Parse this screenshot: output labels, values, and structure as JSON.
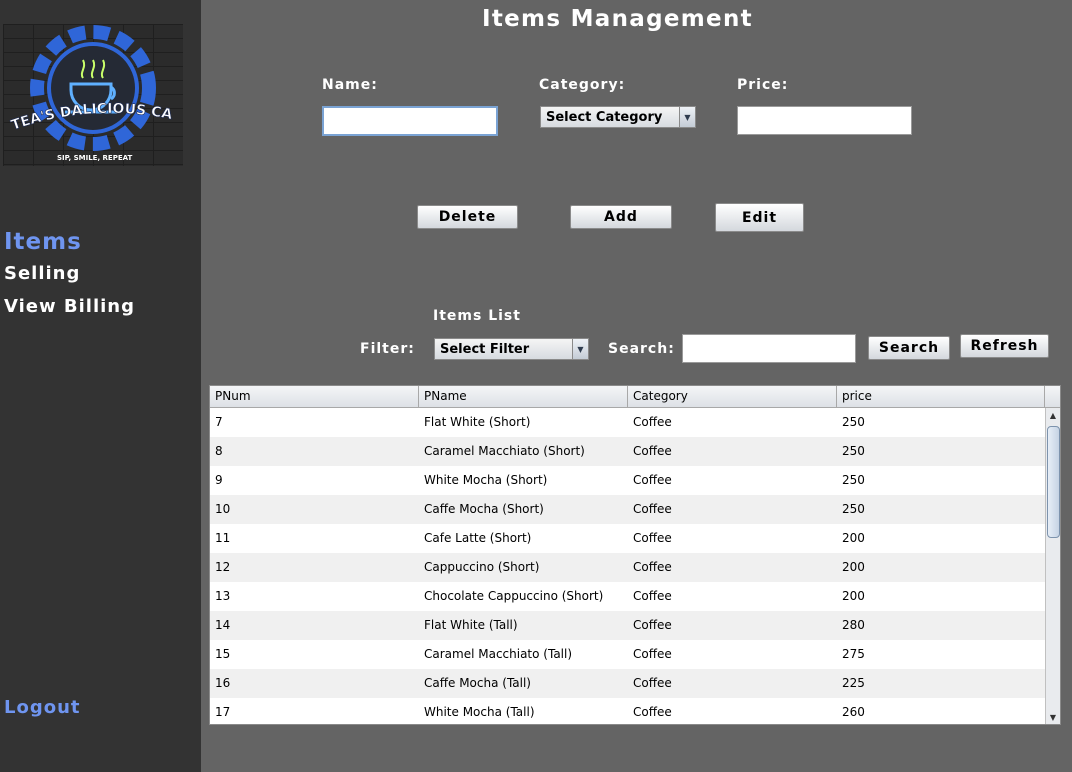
{
  "sidebar": {
    "logo_text": "TEA'S DALICIOUS CAFE",
    "logo_tagline": "SIP, SMILE, REPEAT",
    "nav": [
      "Items",
      "Selling",
      "View Billing"
    ],
    "logout": "Logout",
    "active_color": "#6f95f0"
  },
  "header": {
    "title": "Items Management"
  },
  "form": {
    "name_label": "Name:",
    "name_value": "",
    "category_label": "Category:",
    "category_value": "Select Category",
    "price_label": "Price:",
    "price_value": ""
  },
  "actions": {
    "delete": "Delete",
    "add": "Add",
    "edit": "Edit"
  },
  "list": {
    "title": "Items List",
    "filter_label": "Filter:",
    "filter_value": "Select Filter",
    "search_label": "Search:",
    "search_value": "",
    "search_button": "Search",
    "refresh_button": "Refresh"
  },
  "table": {
    "columns": [
      "PNum",
      "PName",
      "Category",
      "price"
    ],
    "rows": [
      [
        "7",
        "Flat White (Short)",
        "Coffee",
        "250"
      ],
      [
        "8",
        "Caramel Macchiato (Short)",
        "Coffee",
        "250"
      ],
      [
        "9",
        "White Mocha (Short)",
        "Coffee",
        "250"
      ],
      [
        "10",
        "Caffe Mocha (Short)",
        "Coffee",
        "250"
      ],
      [
        "11",
        "Cafe Latte (Short)",
        "Coffee",
        "200"
      ],
      [
        "12",
        "Cappuccino (Short)",
        "Coffee",
        "200"
      ],
      [
        "13",
        "Chocolate Cappuccino (Short)",
        "Coffee",
        "200"
      ],
      [
        "14",
        "Flat White (Tall)",
        "Coffee",
        "280"
      ],
      [
        "15",
        "Caramel Macchiato (Tall)",
        "Coffee",
        "275"
      ],
      [
        "16",
        "Caffe Mocha (Tall)",
        "Coffee",
        "225"
      ],
      [
        "17",
        "White Mocha (Tall)",
        "Coffee",
        "260"
      ]
    ]
  },
  "icons": {
    "combo_arrow": "chevron-down-icon",
    "scroll_up": "arrow-up-icon",
    "scroll_down": "arrow-down-icon"
  }
}
